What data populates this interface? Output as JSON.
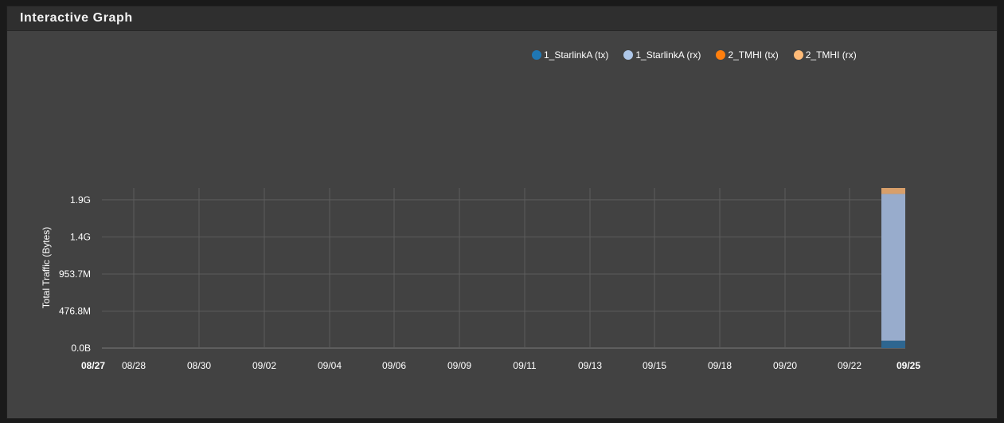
{
  "panel": {
    "title": "Interactive Graph"
  },
  "chart_data": {
    "type": "bar",
    "stacked": true,
    "ylabel": "Total Traffic (Bytes)",
    "y_ticks": [
      "0.0B",
      "476.8M",
      "953.7M",
      "1.4G",
      "1.9G"
    ],
    "y_tick_values": [
      0,
      500000000,
      1000000000,
      1500000000,
      2000000000
    ],
    "ylim": [
      0,
      2160000000
    ],
    "x_ticks": [
      "08/27",
      "08/28",
      "08/30",
      "09/02",
      "09/04",
      "09/06",
      "09/09",
      "09/11",
      "09/13",
      "09/15",
      "09/18",
      "09/20",
      "09/22",
      "09/25"
    ],
    "x_ticks_bold": [
      "08/27",
      "09/25"
    ],
    "grid": true,
    "legend_position": "top-right",
    "series": [
      {
        "name": "1_StarlinkA (tx)",
        "color": "#1f77b4",
        "values": [
          100000000
        ]
      },
      {
        "name": "1_StarlinkA (rx)",
        "color": "#aec7e8",
        "values": [
          1980000000
        ]
      },
      {
        "name": "2_TMHI (tx)",
        "color": "#ff7f0e",
        "values": [
          0
        ]
      },
      {
        "name": "2_TMHI (rx)",
        "color": "#ffbb78",
        "values": [
          80000000
        ]
      }
    ],
    "bar_date": "09/24"
  }
}
